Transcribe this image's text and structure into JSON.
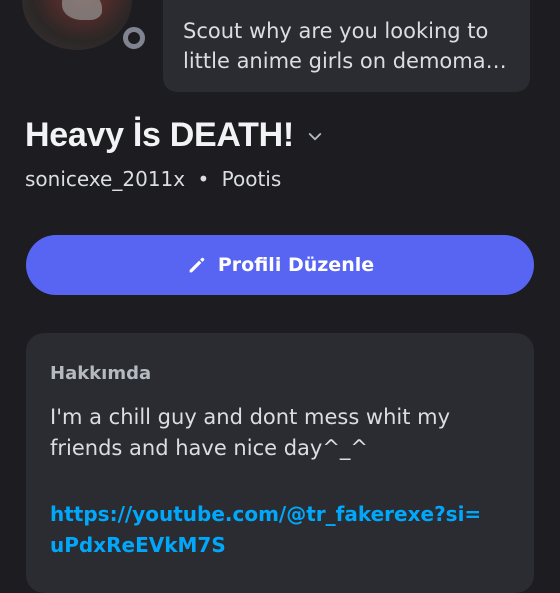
{
  "status_message": {
    "line1": "Scout why are you looking to",
    "line2": "little anime girls on demoman..."
  },
  "profile": {
    "display_name": "Heavy İs DEATH!",
    "username": "sonicexe_2011x",
    "separator": "•",
    "pronouns": "Pootis"
  },
  "edit_button": {
    "label": "Profili Düzenle",
    "icon": "pencil-icon"
  },
  "about": {
    "heading": "Hakkımda",
    "bio_line1": "I'm a chill guy and dont mess whit my",
    "bio_line2": "friends and have nice day^_^",
    "link_line1": "https://youtube.com/@tr_fakerexe?si=",
    "link_line2": "uPdxReEVkM7S"
  },
  "colors": {
    "background": "#1c1c21",
    "card": "#2b2c31",
    "accent": "#5865f2",
    "link": "#00a8fc",
    "status_offline": "#80848e"
  }
}
